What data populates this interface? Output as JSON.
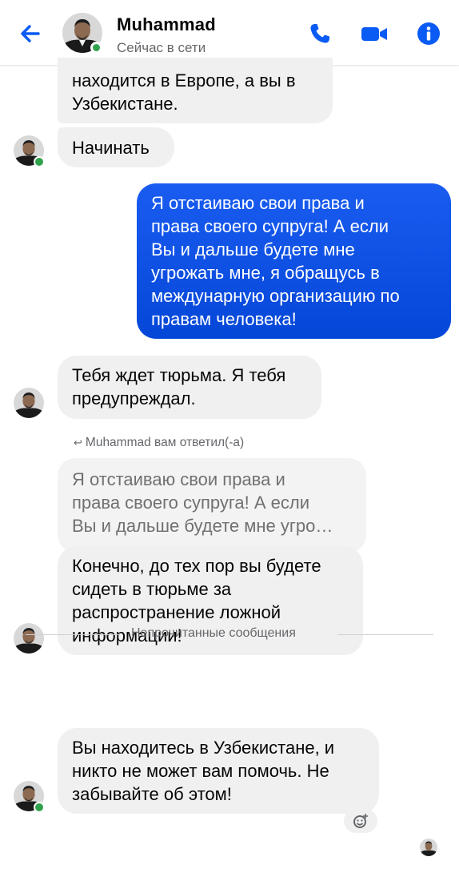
{
  "header": {
    "contact_name": "Muhammad",
    "status": "Сейчас в сети",
    "accent_color": "#0a5bf4",
    "online_color": "#31a24c"
  },
  "messages": [
    {
      "direction": "incoming",
      "text": "находится в Европе, а вы в\nУзбекистане."
    },
    {
      "direction": "incoming",
      "text": "Начинать"
    },
    {
      "direction": "outgoing",
      "text": "Я отстаиваю свои права и\nправа своего супруга! А если\nВы и дальше будете мне\nугрожать мне, я обращусь в\nмеждунарную организацию по\nправам человека!"
    },
    {
      "direction": "incoming",
      "text": "Тебя ждет тюрьма. Я тебя\nпредупреждал."
    },
    {
      "direction": "incoming",
      "text": "Конечно, до тех пор вы будете\nсидеть в тюрьме за\nраспространение ложной\nинформации!"
    },
    {
      "direction": "incoming",
      "text": "Вы находитесь в Узбекистане, и\nникто не может вам помочь. Не\nзабывайте об этом!"
    }
  ],
  "reply": {
    "note": "Muhammad вам ответил(-а)",
    "quoted_text": "Я отстаиваю свои права и\nправа своего супруга! А если\nВы и дальше будете мне угро…"
  },
  "unread_divider": "Непрочитанные сообщения",
  "icons": {
    "back": "arrow-left-icon",
    "call": "phone-icon",
    "video": "video-camera-icon",
    "info": "info-icon",
    "reply": "reply-arrow-icon",
    "reaction": "add-reaction-icon"
  }
}
